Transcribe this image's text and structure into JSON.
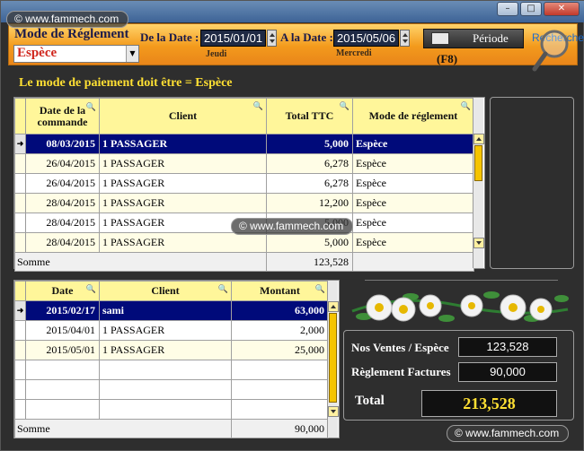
{
  "watermark": "© www.fammech.com",
  "window_controls": {
    "minimize": "–",
    "maximize": "□",
    "close": "✕"
  },
  "toolbar": {
    "mode_label": "Mode de Réglement",
    "mode_value": "Espèce",
    "from_label": "De la Date :",
    "from_date": "2015/01/01",
    "from_day": "Jeudi",
    "to_label": "A la Date :",
    "to_date": "2015/05/06",
    "to_day": "Mercredi",
    "periode_label": "Période",
    "shortcut": "(F8)",
    "search_label": "Recherche"
  },
  "info_line": "Le mode de paiement doit être = Espèce",
  "top_grid": {
    "columns": [
      "Date de la commande",
      "Client",
      "Total TTC",
      "Mode de réglement"
    ],
    "rows": [
      {
        "date": "08/03/2015",
        "client": "1 PASSAGER",
        "total": "5,000",
        "mode": "Espèce",
        "selected": true
      },
      {
        "date": "26/04/2015",
        "client": "1 PASSAGER",
        "total": "6,278",
        "mode": "Espèce"
      },
      {
        "date": "26/04/2015",
        "client": "1 PASSAGER",
        "total": "6,278",
        "mode": "Espèce"
      },
      {
        "date": "28/04/2015",
        "client": "1 PASSAGER",
        "total": "12,200",
        "mode": "Espèce"
      },
      {
        "date": "28/04/2015",
        "client": "1 PASSAGER",
        "total": "5,000",
        "mode": "Espèce"
      },
      {
        "date": "28/04/2015",
        "client": "1 PASSAGER",
        "total": "5,000",
        "mode": "Espèce"
      }
    ],
    "sum_label": "Somme",
    "sum_value": "123,528"
  },
  "bottom_grid": {
    "columns": [
      "Date",
      "Client",
      "Montant"
    ],
    "rows": [
      {
        "date": "2015/02/17",
        "client": "sami",
        "amount": "63,000",
        "selected": true
      },
      {
        "date": "2015/04/01",
        "client": "1 PASSAGER",
        "amount": "2,000"
      },
      {
        "date": "2015/05/01",
        "client": "1 PASSAGER",
        "amount": "25,000"
      }
    ],
    "sum_label": "Somme",
    "sum_value": "90,000"
  },
  "totals": {
    "sales_label": "Nos Ventes / Espèce",
    "sales_value": "123,528",
    "settlements_label": "Règlement Factures",
    "settlements_value": "90,000",
    "total_label": "Total",
    "total_value": "213,528"
  },
  "colors": {
    "accent": "#f39a1c",
    "selection": "#000a7a",
    "header": "#fff69a",
    "highlight": "#ffe033"
  }
}
